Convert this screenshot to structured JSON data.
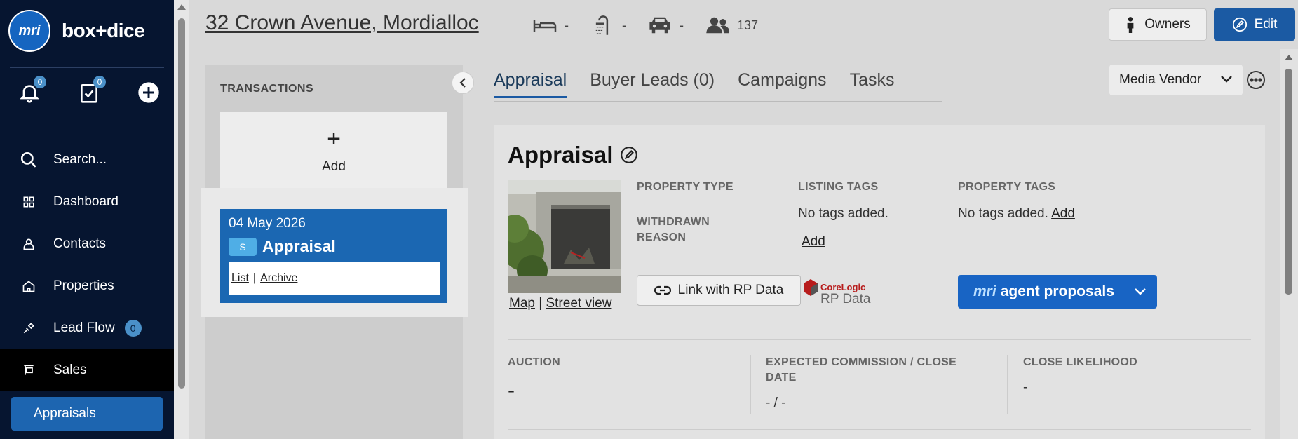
{
  "sidebar": {
    "logo_text": "mri",
    "brand_left": "box",
    "brand_plus": "+",
    "brand_right": "dice",
    "notifications_count": "0",
    "tasks_count": "0",
    "items": [
      {
        "label": "Search...",
        "icon": "search-icon"
      },
      {
        "label": "Dashboard",
        "icon": "grid-icon"
      },
      {
        "label": "Contacts",
        "icon": "person-icon"
      },
      {
        "label": "Properties",
        "icon": "house-icon"
      },
      {
        "label": "Lead Flow",
        "icon": "lead-flow-icon",
        "count": "0"
      },
      {
        "label": "Sales",
        "icon": "sign-icon"
      },
      {
        "label": "Appraisals",
        "icon": ""
      }
    ]
  },
  "header": {
    "address": "32 Crown Avenue, Mordialloc",
    "beds": "-",
    "baths": "-",
    "cars": "-",
    "contacts": "137",
    "owners_label": "Owners",
    "edit_label": "Edit"
  },
  "transactions": {
    "title": "TRANSACTIONS",
    "add_symbol": "+",
    "add_label": "Add",
    "card": {
      "date": "04 May 2026",
      "badge": "S",
      "name": "Appraisal",
      "list_link": "List",
      "separator": "|",
      "archive_link": "Archive"
    }
  },
  "tabs": [
    {
      "label": "Appraisal",
      "active": true
    },
    {
      "label": "Buyer Leads (0)",
      "active": false
    },
    {
      "label": "Campaigns",
      "active": false
    },
    {
      "label": "Tasks",
      "active": false
    }
  ],
  "media_vendor": "Media Vendor",
  "appraisal": {
    "title": "Appraisal",
    "map_link": "Map",
    "link_sep": "|",
    "street_link": "Street view",
    "property_type_label": "PROPERTY TYPE",
    "withdrawn_label": "WITHDRAWN REASON",
    "listing_tags_label": "LISTING TAGS",
    "listing_tags_value": "No tags added.",
    "listing_add": "Add",
    "property_tags_label": "PROPERTY TAGS",
    "property_tags_value": "No tags added.",
    "property_add": "Add",
    "rp_button": "Link with RP Data",
    "corelogic_top": "CoreLogic",
    "corelogic_bottom": "RP Data",
    "agent_mri": "mri",
    "agent_label": "agent proposals",
    "auction_label": "AUCTION",
    "auction_value": "-",
    "commission_label": "EXPECTED COMMISSION / CLOSE DATE",
    "commission_value": "- / -",
    "likelihood_label": "CLOSE LIKELIHOOD",
    "likelihood_value": "-"
  },
  "colors": {
    "sidebar_bg": "#061530",
    "accent": "#1b5aa3",
    "card_blue": "#1b67b2",
    "badge": "#4faee6"
  }
}
